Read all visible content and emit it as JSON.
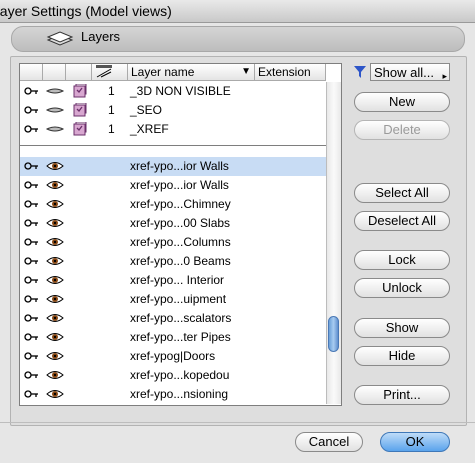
{
  "window": {
    "title": "Layer Settings (Model views)"
  },
  "header": {
    "icon": "layers-icon",
    "label": "Layers"
  },
  "table": {
    "columns": {
      "name": "Layer name",
      "extension": "Extension"
    },
    "special_rows": [
      {
        "number": "1",
        "name": "_3D NON VISIBLE"
      },
      {
        "number": "1",
        "name": "_SEO"
      },
      {
        "number": "1",
        "name": "_XREF"
      }
    ],
    "rows": [
      {
        "name": "xref-ypo...ior Walls"
      },
      {
        "name": "xref-ypo...ior Walls"
      },
      {
        "name": "xref-ypo...Chimney"
      },
      {
        "name": "xref-ypo...00 Slabs"
      },
      {
        "name": "xref-ypo...Columns"
      },
      {
        "name": "xref-ypo...0 Beams"
      },
      {
        "name": "xref-ypo... Interior"
      },
      {
        "name": "xref-ypo...uipment"
      },
      {
        "name": "xref-ypo...scalators"
      },
      {
        "name": "xref-ypo...ter Pipes"
      },
      {
        "name": "xref-ypog|Doors"
      },
      {
        "name": "xref-ypo...kopedou"
      },
      {
        "name": "xref-ypo...nsioning"
      }
    ],
    "selected_index": 0
  },
  "filter": {
    "label": "Show all..."
  },
  "buttons": {
    "new": "New",
    "delete": "Delete",
    "select_all": "Select All",
    "deselect_all": "Deselect All",
    "lock": "Lock",
    "unlock": "Unlock",
    "show": "Show",
    "hide": "Hide",
    "print": "Print...",
    "cancel": "Cancel",
    "ok": "OK"
  },
  "colors": {
    "selection": "#c8dcf4",
    "default_button": "#5aa3ec"
  }
}
